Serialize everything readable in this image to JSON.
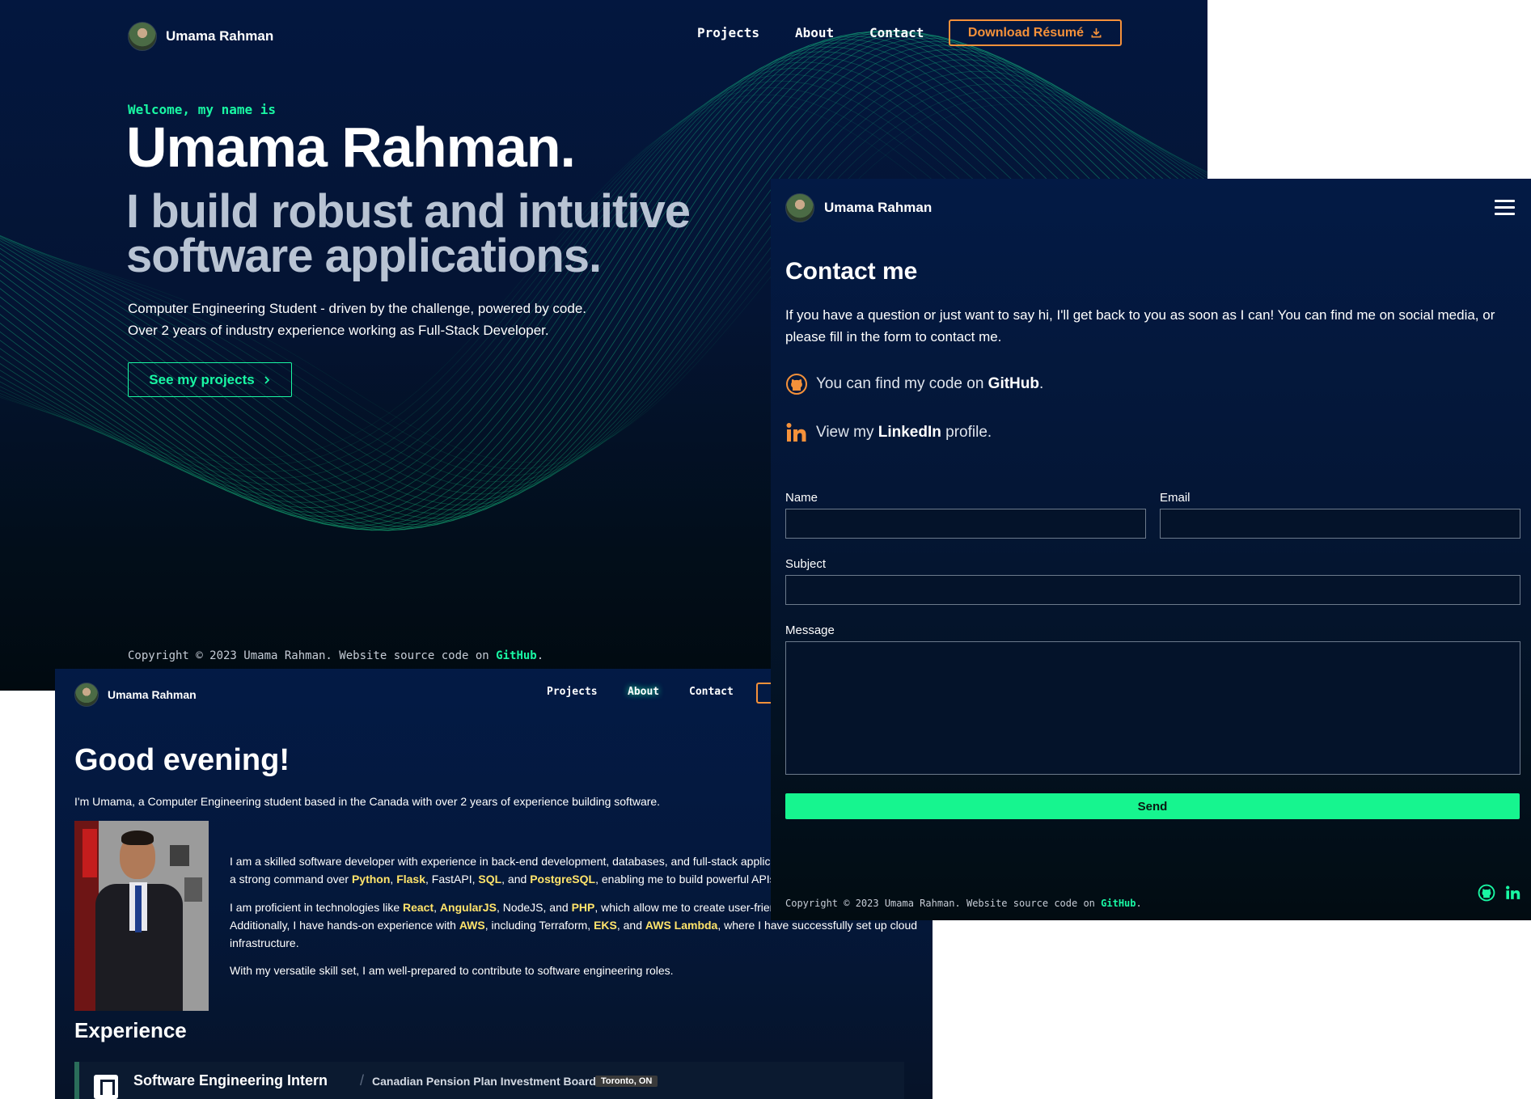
{
  "home": {
    "brand": {
      "name": "Umama Rahman"
    },
    "nav": {
      "projects": "Projects",
      "about": "About",
      "contact": "Contact",
      "resume": "Download Résumé"
    },
    "hero": {
      "welcome": "Welcome, my name is",
      "name": "Umama Rahman.",
      "tagline": "I build robust and intuitive software applications.",
      "desc_line1": "Computer Engineering Student - driven by the challenge, powered by code.",
      "desc_line2": "Over 2 years of industry experience working as Full-Stack Developer.",
      "cta": "See my projects"
    },
    "footer": {
      "text": "Copyright © 2023 Umama Rahman. Website source code on ",
      "link": "GitHub",
      "end": "."
    }
  },
  "about": {
    "brand": {
      "name": "Umama Rahman"
    },
    "nav": {
      "projects": "Projects",
      "about": "About",
      "contact": "Contact"
    },
    "greeting": "Good evening!",
    "intro": "I'm Umama, a Computer Engineering student based in the Canada with over 2 years of experience building software.",
    "para1": {
      "text1": "I am a skilled software developer with experience in back-end development, databases, and full-stack applica",
      "text2": "a strong command over ",
      "python": "Python",
      "flask": "Flask",
      "text3": ", FastAPI, ",
      "sql": "SQL",
      "text4": ", and ",
      "postgres": "PostgreSQL",
      "text5": ", enabling me to build powerful APIs and"
    },
    "para2": {
      "text1": "I am proficient in technologies like ",
      "react": "React",
      "angular": "AngularJS",
      "text2": ", NodeJS, and ",
      "php": "PHP",
      "text3": ", which allow me to create user-friendly",
      "text4": "Additionally, I have hands-on experience with ",
      "aws": "AWS",
      "text5": ", including Terraform, ",
      "eks": "EKS",
      "text6": ", and ",
      "lambda": "AWS Lambda",
      "text7": ", where I have successfully set up cloud",
      "text8": "infrastructure."
    },
    "para3": "With my versatile skill set, I am well-prepared to contribute to software engineering roles.",
    "experience_title": "Experience",
    "job": {
      "role": "Software Engineering Intern",
      "sep": "/",
      "org": "Canadian Pension Plan Investment Board",
      "location": "Toronto, ON"
    }
  },
  "contact": {
    "brand": {
      "name": "Umama Rahman"
    },
    "title": "Contact me",
    "desc": "If you have a question or just want to say hi, I'll get back to you as soon as I can! You can find me on social media, or please fill in the form to contact me.",
    "github_row": {
      "prefix": "You can find my code on ",
      "link": "GitHub",
      "suffix": "."
    },
    "linkedin_row": {
      "prefix": "View my ",
      "link": "LinkedIn",
      "suffix": " profile."
    },
    "form": {
      "name_label": "Name",
      "name_value": "",
      "email_label": "Email",
      "email_value": "",
      "subject_label": "Subject",
      "subject_value": "",
      "message_label": "Message",
      "message_value": "",
      "send": "Send"
    },
    "footer": {
      "text": "Copyright © 2023 Umama Rahman. Website source code on ",
      "link": "GitHub",
      "end": "."
    }
  },
  "colors": {
    "accent_green": "#19f7a3",
    "accent_orange": "#f5913a",
    "navy": "#03173f",
    "send_green": "#16f58f"
  },
  "icons": [
    "avatar",
    "download-icon",
    "chevron-right-icon",
    "github-icon",
    "linkedin-icon",
    "hamburger-menu-icon"
  ]
}
